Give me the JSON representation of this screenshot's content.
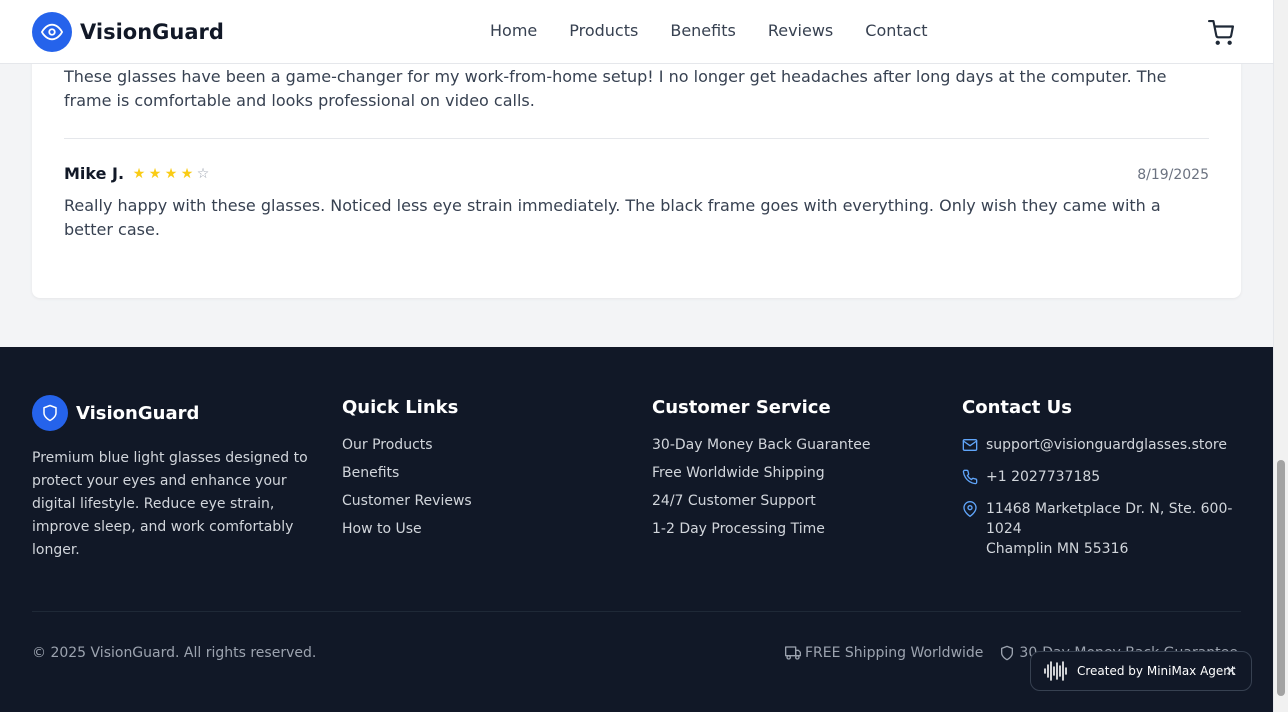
{
  "header": {
    "brand": "VisionGuard",
    "nav": [
      "Home",
      "Products",
      "Benefits",
      "Reviews",
      "Contact"
    ]
  },
  "reviews": [
    {
      "text": "These glasses have been a game-changer for my work-from-home setup! I no longer get headaches after long days at the computer. The frame is comfortable and looks professional on video calls."
    },
    {
      "name": "Mike J.",
      "rating": 4,
      "max_rating": 5,
      "date": "8/19/2025",
      "text": "Really happy with these glasses. Noticed less eye strain immediately. The black frame goes with everything. Only wish they came with a better case."
    }
  ],
  "footer": {
    "brand": "VisionGuard",
    "description": "Premium blue light glasses designed to protect your eyes and enhance your digital lifestyle. Reduce eye strain, improve sleep, and work comfortably longer.",
    "quick_links": {
      "heading": "Quick Links",
      "items": [
        "Our Products",
        "Benefits",
        "Customer Reviews",
        "How to Use"
      ]
    },
    "customer_service": {
      "heading": "Customer Service",
      "items": [
        "30-Day Money Back Guarantee",
        "Free Worldwide Shipping",
        "24/7 Customer Support",
        "1-2 Day Processing Time"
      ]
    },
    "contact": {
      "heading": "Contact Us",
      "email": "support@visionguardglasses.store",
      "phone": "+1 2027737185",
      "address_line1": "11468 Marketplace Dr. N, Ste. 600-1024",
      "address_line2": "Champlin MN 55316"
    },
    "copyright": "© 2025 VisionGuard. All rights reserved.",
    "badges": [
      "FREE Shipping Worldwide",
      "30-Day Money Back Guarantee"
    ]
  },
  "toast": {
    "text": "Created by MiniMax Agent",
    "close": "×"
  },
  "colors": {
    "accent": "#2563eb",
    "star": "#facc15",
    "footer_bg": "#111827"
  },
  "icons": [
    "eye-icon",
    "cart-icon",
    "star-icon",
    "shield-icon",
    "mail-icon",
    "phone-icon",
    "map-pin-icon",
    "truck-icon",
    "waveform-icon",
    "close-icon"
  ]
}
